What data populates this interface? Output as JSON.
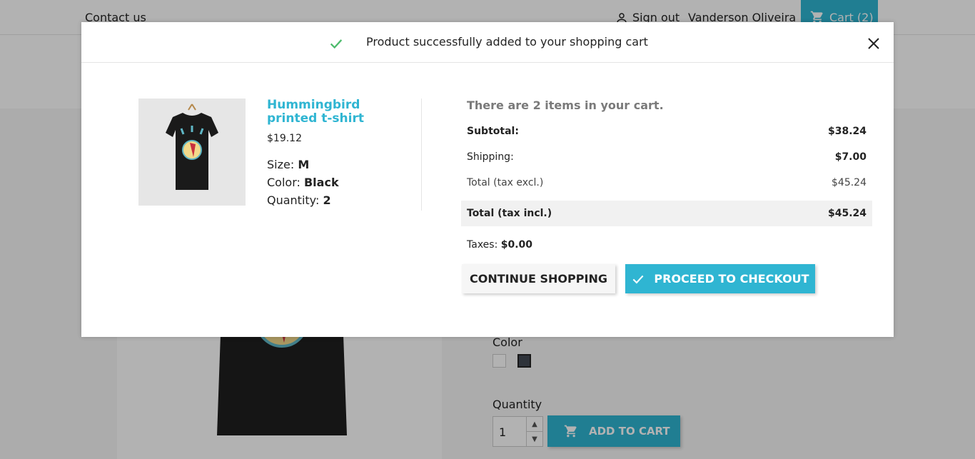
{
  "header": {
    "contact": "Contact us",
    "sign_out": "Sign out",
    "user_name": "Vanderson Oliveira",
    "cart": "Cart (2)"
  },
  "product_page": {
    "color_label": "Color",
    "quantity_label": "Quantity",
    "quantity_value": "1",
    "add_to_cart": "ADD TO CART"
  },
  "modal": {
    "title": "Product successfully added to your shopping cart",
    "product": {
      "name": "Hummingbird printed t-shirt",
      "price": "$19.12",
      "size_label": "Size:",
      "size_value": "M",
      "color_label": "Color:",
      "color_value": "Black",
      "quantity_label": "Quantity:",
      "quantity_value": "2"
    },
    "summary": {
      "count_text": "There are 2 items in your cart.",
      "subtotal_label": "Subtotal:",
      "subtotal_value": "$38.24",
      "shipping_label": "Shipping:",
      "shipping_value": "$7.00",
      "total_excl_label": "Total (tax excl.)",
      "total_excl_value": "$45.24",
      "total_incl_label": "Total (tax incl.)",
      "total_incl_value": "$45.24",
      "taxes_label": "Taxes:",
      "taxes_value": "$0.00"
    },
    "buttons": {
      "continue": "CONTINUE SHOPPING",
      "checkout": "PROCEED TO CHECKOUT"
    }
  },
  "colors": {
    "accent": "#2fb5d2",
    "success": "#4cbb6c"
  }
}
